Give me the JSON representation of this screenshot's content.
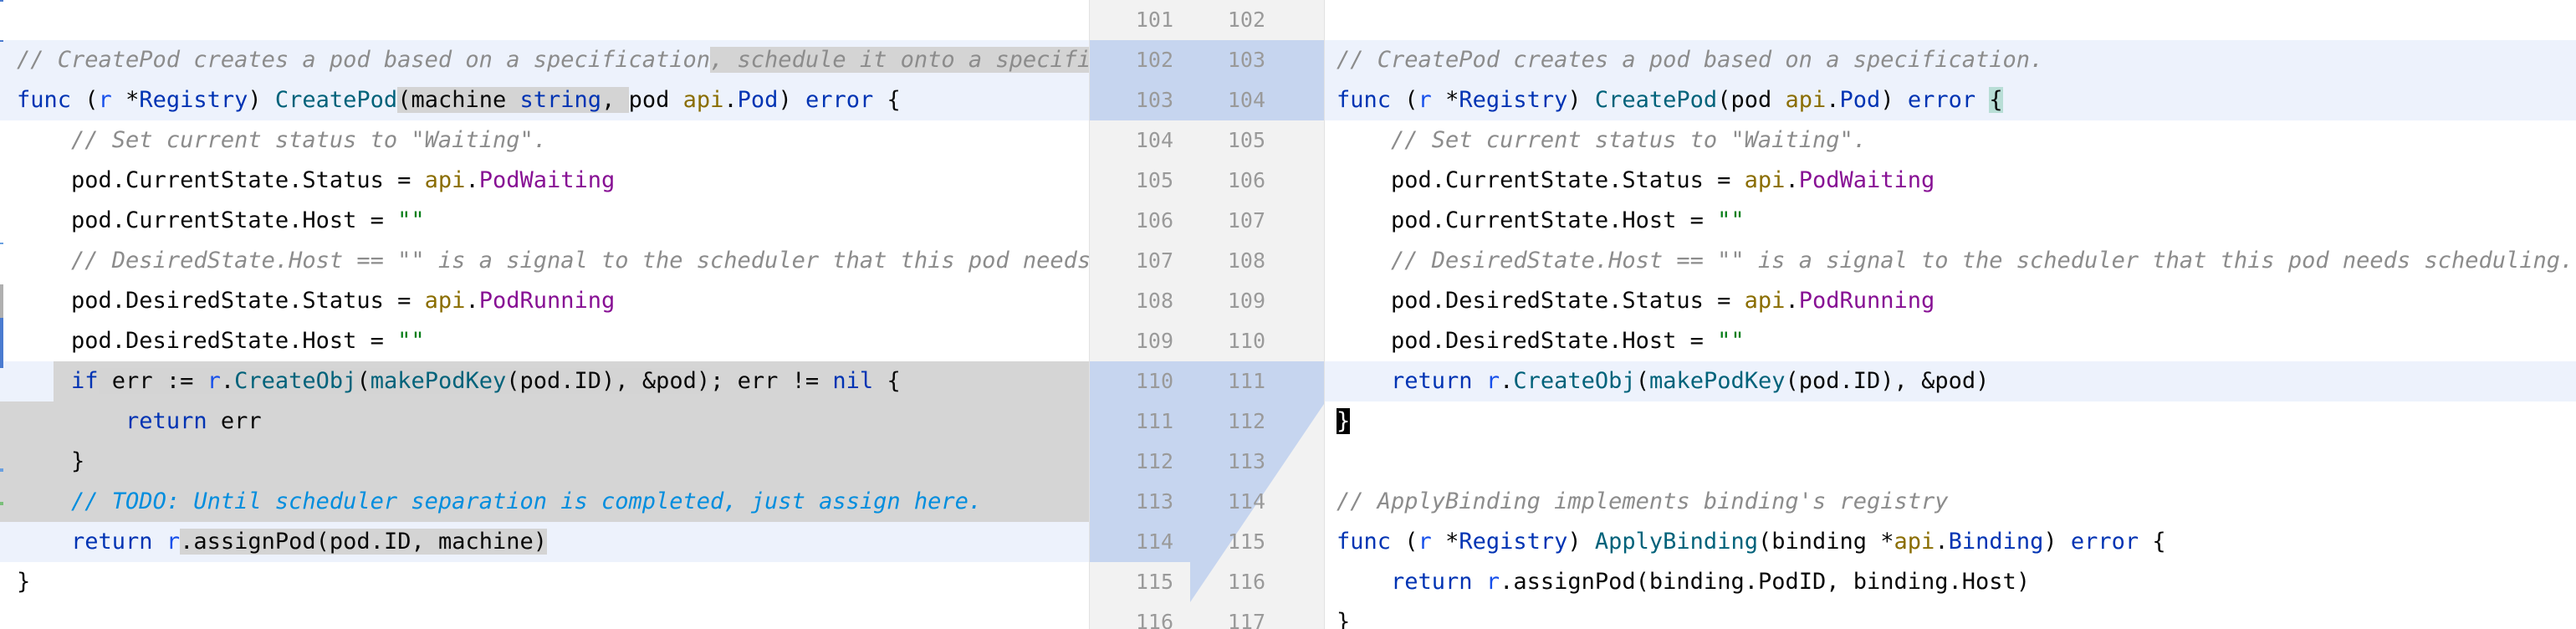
{
  "diff": {
    "left": {
      "lines": [
        [
          {
            "t": "// CreatePod creates a pod based on a specification",
            "c": "cm"
          },
          {
            "t": ", schedule it onto a specifi",
            "c": "cm inline-gray"
          }
        ],
        [
          {
            "t": "func",
            "c": "kw"
          },
          {
            "t": " ("
          },
          {
            "t": "r",
            "c": "recv"
          },
          {
            "t": " *"
          },
          {
            "t": "Registry",
            "c": "ty"
          },
          {
            "t": ") "
          },
          {
            "t": "CreatePod",
            "c": "fn"
          },
          {
            "t": "(machine ",
            "c": "inline-gray"
          },
          {
            "t": "string",
            "c": "ty inline-gray"
          },
          {
            "t": ", ",
            "c": "inline-gray"
          },
          {
            "t": "pod "
          },
          {
            "t": "api",
            "c": "pkg"
          },
          {
            "t": "."
          },
          {
            "t": "Pod",
            "c": "ty"
          },
          {
            "t": ") "
          },
          {
            "t": "error",
            "c": "kw"
          },
          {
            "t": " {"
          }
        ],
        [
          {
            "t": "    "
          },
          {
            "t": "// Set current status to \"Waiting\".",
            "c": "cm"
          }
        ],
        [
          {
            "t": "    pod.CurrentState.Status = "
          },
          {
            "t": "api",
            "c": "pkg"
          },
          {
            "t": "."
          },
          {
            "t": "PodWaiting",
            "c": "ident-purple"
          }
        ],
        [
          {
            "t": "    pod.CurrentState.Host = "
          },
          {
            "t": "\"\"",
            "c": "str"
          }
        ],
        [
          {
            "t": "    "
          },
          {
            "t": "// DesiredState.Host == \"\" is a signal to the scheduler that this pod needs",
            "c": "cm"
          }
        ],
        [
          {
            "t": "    pod.DesiredState.Status = "
          },
          {
            "t": "api",
            "c": "pkg"
          },
          {
            "t": "."
          },
          {
            "t": "PodRunning",
            "c": "ident-purple"
          }
        ],
        [
          {
            "t": "    pod.DesiredState.Host = "
          },
          {
            "t": "\"\"",
            "c": "str"
          }
        ],
        [
          {
            "t": "    "
          },
          {
            "t": "if",
            "c": "kw"
          },
          {
            "t": " err := ",
            "c": "inline-gray"
          },
          {
            "t": "r",
            "c": "recv inline-gray"
          },
          {
            "t": ".",
            "c": "inline-gray"
          },
          {
            "t": "CreateObj",
            "c": "fn inline-gray"
          },
          {
            "t": "(",
            "c": "inline-gray"
          },
          {
            "t": "makePodKey",
            "c": "fn inline-gray"
          },
          {
            "t": "(pod.ID), &pod)",
            "c": "inline-gray"
          },
          {
            "t": "; err != "
          },
          {
            "t": "nil",
            "c": "kw"
          },
          {
            "t": " {"
          }
        ],
        [
          {
            "t": "        "
          },
          {
            "t": "return",
            "c": "kw"
          },
          {
            "t": " err"
          }
        ],
        [
          {
            "t": "    }"
          }
        ],
        [
          {
            "t": "    "
          },
          {
            "t": "// TODO: Until scheduler separation is completed, just assign here.",
            "c": "cm-todo"
          }
        ],
        [
          {
            "t": "    "
          },
          {
            "t": "return",
            "c": "kw"
          },
          {
            "t": " "
          },
          {
            "t": "r",
            "c": "recv"
          },
          {
            "t": ".assignPod(pod.ID, machine)",
            "c": "inline-gray"
          }
        ],
        [
          {
            "t": "}"
          }
        ]
      ]
    },
    "gutter": {
      "left_numbers": [
        "101",
        "102",
        "103",
        "104",
        "105",
        "106",
        "107",
        "108",
        "109",
        "110",
        "111",
        "112",
        "113",
        "114",
        "115",
        "116"
      ],
      "right_numbers": [
        "102",
        "103",
        "104",
        "105",
        "106",
        "107",
        "108",
        "109",
        "110",
        "111",
        "112",
        "113",
        "114",
        "115",
        "116",
        "117"
      ]
    },
    "right": {
      "lines": [
        [
          {
            "t": "// CreatePod creates a pod based on a specification.",
            "c": "cm"
          }
        ],
        [
          {
            "t": "func",
            "c": "kw"
          },
          {
            "t": " ("
          },
          {
            "t": "r",
            "c": "recv"
          },
          {
            "t": " *"
          },
          {
            "t": "Registry",
            "c": "ty"
          },
          {
            "t": ") "
          },
          {
            "t": "CreatePod",
            "c": "fn"
          },
          {
            "t": "(pod "
          },
          {
            "t": "api",
            "c": "pkg"
          },
          {
            "t": "."
          },
          {
            "t": "Pod",
            "c": "ty"
          },
          {
            "t": ") "
          },
          {
            "t": "error",
            "c": "kw"
          },
          {
            "t": " "
          },
          {
            "t": "{",
            "c": "match-brace"
          }
        ],
        [
          {
            "t": "    "
          },
          {
            "t": "// Set current status to \"Waiting\".",
            "c": "cm"
          }
        ],
        [
          {
            "t": "    pod.CurrentState.Status = "
          },
          {
            "t": "api",
            "c": "pkg"
          },
          {
            "t": "."
          },
          {
            "t": "PodWaiting",
            "c": "ident-purple"
          }
        ],
        [
          {
            "t": "    pod.CurrentState.Host = "
          },
          {
            "t": "\"\"",
            "c": "str"
          }
        ],
        [
          {
            "t": "    "
          },
          {
            "t": "// DesiredState.Host == \"\" is a signal to the scheduler that this pod needs scheduling.",
            "c": "cm"
          }
        ],
        [
          {
            "t": "    pod.DesiredState.Status = "
          },
          {
            "t": "api",
            "c": "pkg"
          },
          {
            "t": "."
          },
          {
            "t": "PodRunning",
            "c": "ident-purple"
          }
        ],
        [
          {
            "t": "    pod.DesiredState.Host = "
          },
          {
            "t": "\"\"",
            "c": "str"
          }
        ],
        [
          {
            "t": "    "
          },
          {
            "t": "return",
            "c": "kw"
          },
          {
            "t": " "
          },
          {
            "t": "r",
            "c": "recv"
          },
          {
            "t": "."
          },
          {
            "t": "CreateObj",
            "c": "fn"
          },
          {
            "t": "("
          },
          {
            "t": "makePodKey",
            "c": "fn"
          },
          {
            "t": "(pod.ID), &pod)"
          }
        ],
        [
          {
            "t": "}",
            "c": "caret-block"
          }
        ],
        [
          {
            "t": ""
          }
        ],
        [
          {
            "t": "// ApplyBinding implements binding's registry",
            "c": "cm"
          }
        ],
        [
          {
            "t": "func",
            "c": "kw"
          },
          {
            "t": " ("
          },
          {
            "t": "r",
            "c": "recv"
          },
          {
            "t": " *"
          },
          {
            "t": "Registry",
            "c": "ty"
          },
          {
            "t": ") "
          },
          {
            "t": "ApplyBinding",
            "c": "fn"
          },
          {
            "t": "(binding *"
          },
          {
            "t": "api",
            "c": "pkg"
          },
          {
            "t": "."
          },
          {
            "t": "Binding",
            "c": "ty"
          },
          {
            "t": ") "
          },
          {
            "t": "error",
            "c": "kw"
          },
          {
            "t": " {"
          }
        ],
        [
          {
            "t": "    "
          },
          {
            "t": "return",
            "c": "kw"
          },
          {
            "t": " "
          },
          {
            "t": "r",
            "c": "recv"
          },
          {
            "t": ".assignPod(binding.PodID, binding.Host)"
          }
        ],
        [
          {
            "t": "}"
          }
        ]
      ]
    }
  },
  "colors": {
    "changed_line_bg": "#edf2fc",
    "removed_block_bg": "#d5d5d5",
    "gutter_band": "#c6d5ef",
    "comment": "#8c8c8c",
    "keyword": "#0033b3",
    "string": "#067d17",
    "function": "#00627a",
    "package": "#8a6d00",
    "constant": "#871094"
  }
}
